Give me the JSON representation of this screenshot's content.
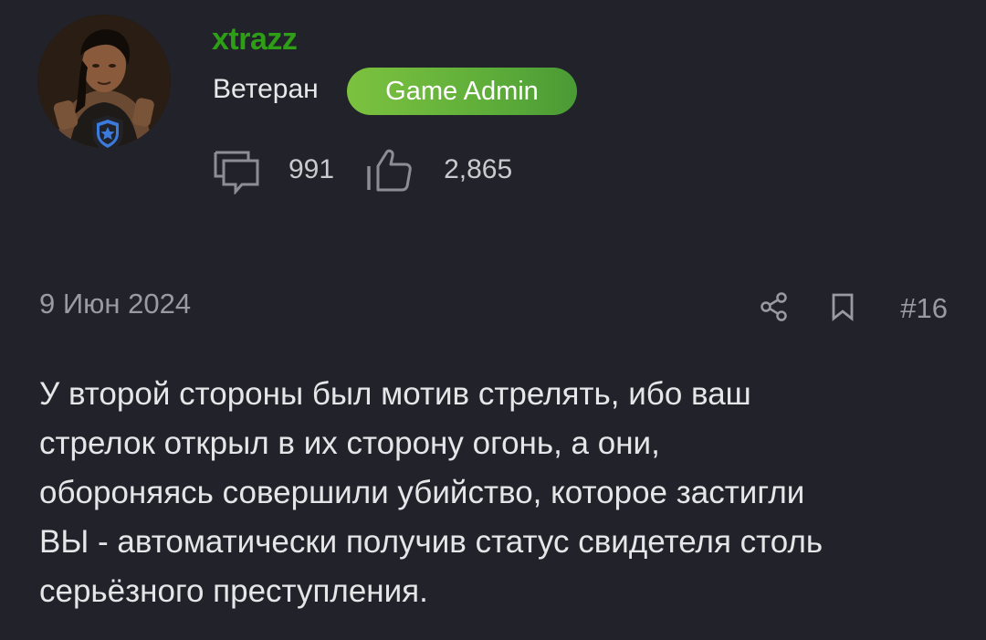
{
  "author": {
    "username": "xtrazz",
    "rank": "Ветеран",
    "role_badge": "Game Admin",
    "avatar_icon": "profile-photo",
    "avatar_badge_icon": "shield-star-icon",
    "username_color": "#2e9e16",
    "badge_color": "#6cba3c",
    "messages_count": "991",
    "reactions_count": "2,865",
    "messages_icon": "speech-bubble-icon",
    "reactions_icon": "thumbs-up-icon"
  },
  "post": {
    "date": "9 Июн 2024",
    "number": "#16",
    "share_icon": "share-icon",
    "bookmark_icon": "bookmark-icon",
    "lines": [
      "У второй стороны был мотив стрелять, ибо ваш",
      "стрелок открыл в их сторону огонь, а они,",
      "обороняясь совершили убийство, которое застигли",
      "ВЫ - автоматически получив статус свидетеля столь",
      "серьёзного преступления."
    ]
  },
  "theme": {
    "background": "#22232a",
    "text": "#e6e6e9",
    "muted": "#9a9ba2"
  }
}
